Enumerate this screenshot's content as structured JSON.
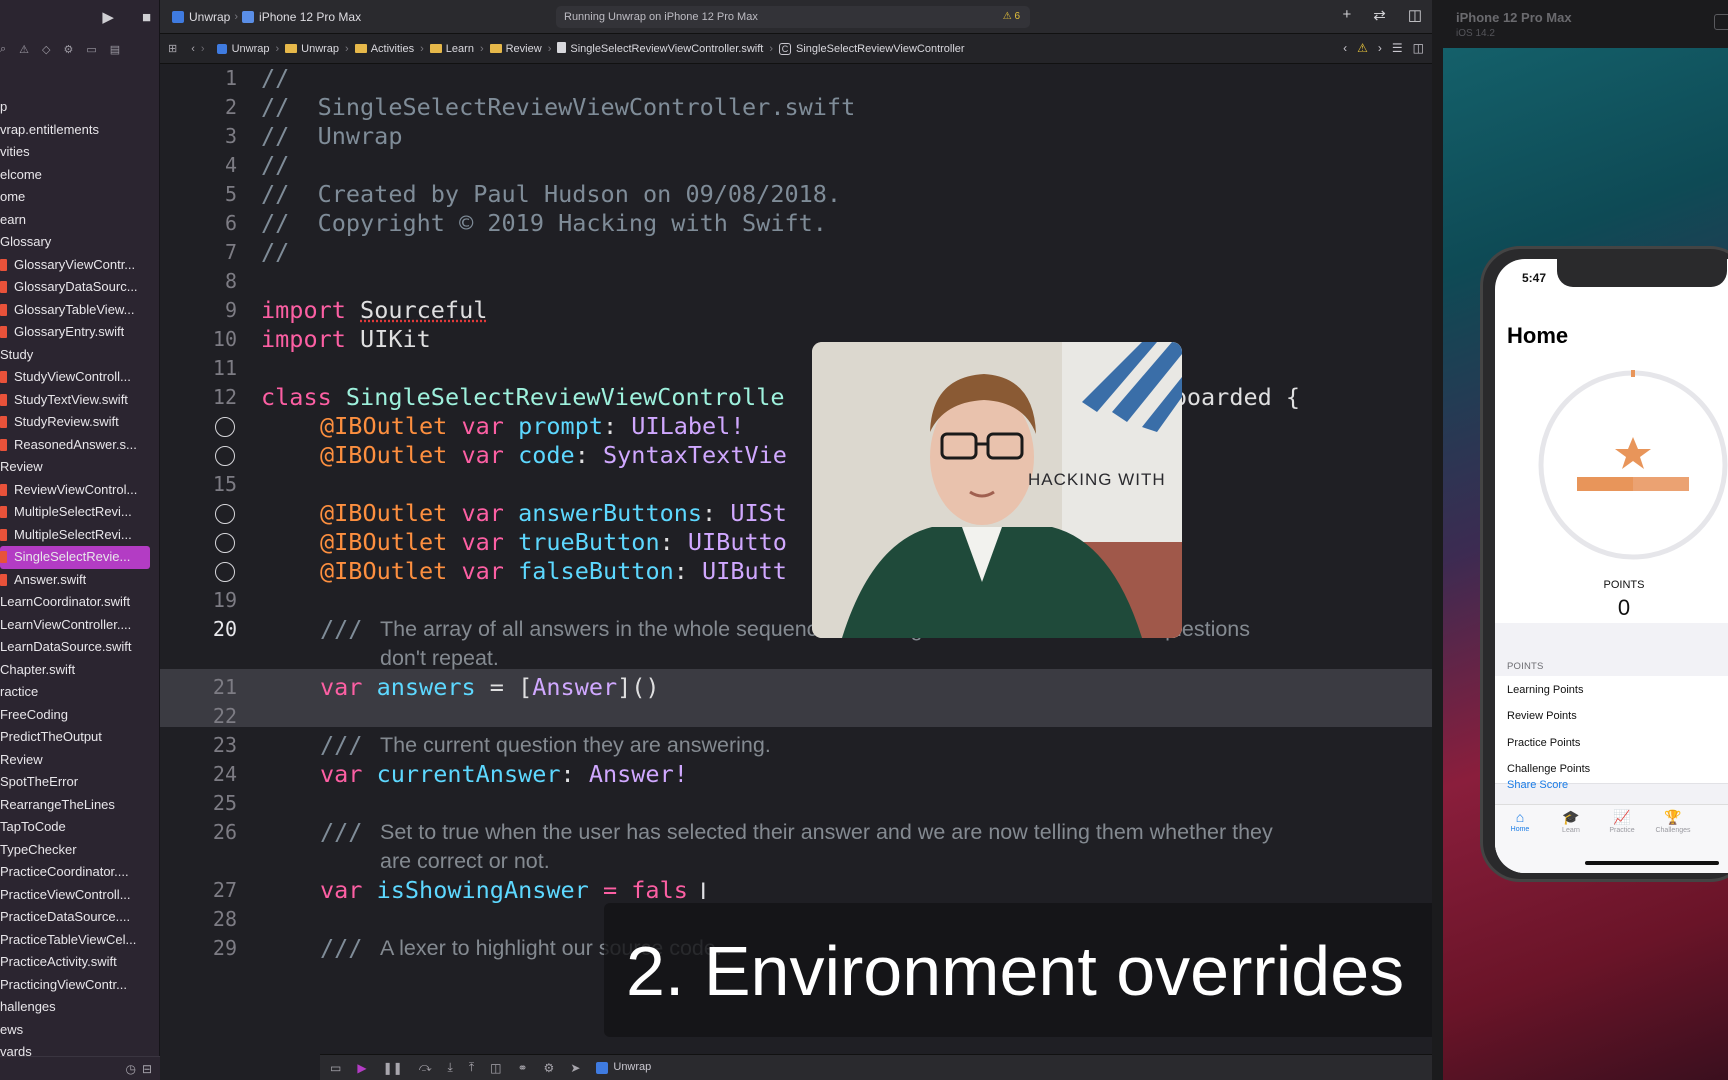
{
  "toolbar": {
    "scheme": "Unwrap",
    "device": "iPhone 12 Pro Max",
    "activity": "Running Unwrap on iPhone 12 Pro Max",
    "warnings": "6"
  },
  "jump_bar": [
    "Unwrap",
    "Unwrap",
    "Activities",
    "Learn",
    "Review",
    "SingleSelectReviewViewController.swift",
    "SingleSelectReviewViewController"
  ],
  "sidebar": {
    "items": [
      {
        "label": "p",
        "kind": "folder"
      },
      {
        "label": "vrap.entitlements",
        "kind": "folder"
      },
      {
        "label": "vities",
        "kind": "folder"
      },
      {
        "label": "elcome",
        "kind": "folder"
      },
      {
        "label": "ome",
        "kind": "folder"
      },
      {
        "label": "earn",
        "kind": "folder"
      },
      {
        "label": "Glossary",
        "kind": "folder"
      },
      {
        "label": "GlossaryViewContr...",
        "kind": "file"
      },
      {
        "label": "GlossaryDataSourc...",
        "kind": "file"
      },
      {
        "label": "GlossaryTableView...",
        "kind": "file"
      },
      {
        "label": "GlossaryEntry.swift",
        "kind": "file"
      },
      {
        "label": "Study",
        "kind": "folder"
      },
      {
        "label": "StudyViewControll...",
        "kind": "file"
      },
      {
        "label": "StudyTextView.swift",
        "kind": "file"
      },
      {
        "label": "StudyReview.swift",
        "kind": "file"
      },
      {
        "label": "ReasonedAnswer.s...",
        "kind": "file"
      },
      {
        "label": "Review",
        "kind": "folder"
      },
      {
        "label": "ReviewViewControl...",
        "kind": "file"
      },
      {
        "label": "MultipleSelectRevi...",
        "kind": "file"
      },
      {
        "label": "MultipleSelectRevi...",
        "kind": "file"
      },
      {
        "label": "SingleSelectRevie...",
        "kind": "file",
        "selected": true
      },
      {
        "label": "Answer.swift",
        "kind": "file"
      },
      {
        "label": "LearnCoordinator.swift",
        "kind": "folder"
      },
      {
        "label": "LearnViewController....",
        "kind": "folder"
      },
      {
        "label": "LearnDataSource.swift",
        "kind": "folder"
      },
      {
        "label": "Chapter.swift",
        "kind": "folder"
      },
      {
        "label": "ractice",
        "kind": "folder"
      },
      {
        "label": "FreeCoding",
        "kind": "folder"
      },
      {
        "label": "PredictTheOutput",
        "kind": "folder"
      },
      {
        "label": "Review",
        "kind": "folder"
      },
      {
        "label": "SpotTheError",
        "kind": "folder"
      },
      {
        "label": "RearrangeTheLines",
        "kind": "folder"
      },
      {
        "label": "TapToCode",
        "kind": "folder"
      },
      {
        "label": "TypeChecker",
        "kind": "folder"
      },
      {
        "label": "PracticeCoordinator....",
        "kind": "folder"
      },
      {
        "label": "PracticeViewControll...",
        "kind": "folder"
      },
      {
        "label": "PracticeDataSource....",
        "kind": "folder"
      },
      {
        "label": "PracticeTableViewCel...",
        "kind": "folder"
      },
      {
        "label": "PracticeActivity.swift",
        "kind": "folder"
      },
      {
        "label": "PracticingViewContr...",
        "kind": "folder"
      },
      {
        "label": "hallenges",
        "kind": "folder"
      },
      {
        "label": "ews",
        "kind": "folder"
      },
      {
        "label": "vards",
        "kind": "folder"
      }
    ]
  },
  "code": {
    "line_numbers": [
      "1",
      "2",
      "3",
      "4",
      "5",
      "6",
      "7",
      "8",
      "9",
      "10",
      "11",
      "12",
      "",
      "",
      "15",
      "",
      "",
      "",
      "19",
      "20",
      "21",
      "22",
      "23",
      "24",
      "25",
      "26",
      "27",
      "28",
      "29"
    ],
    "l1": "//",
    "l2": "//  SingleSelectReviewViewController.swift",
    "l3": "//  Unwrap",
    "l4": "//",
    "l5": "//  Created by Paul Hudson on 09/08/2018.",
    "l6": "//  Copyright © 2019 Hacking with Swift.",
    "l7": "//",
    "l9_kw": "import",
    "l9_mod": "Sourceful",
    "l10_kw": "import",
    "l10_mod": "UIKit",
    "l12_kw": "class",
    "l12_name": "SingleSelectReviewViewControlle",
    "l12_tail": "Storyboarded {",
    "l13": {
      "attr": "@IBOutlet",
      "kw": "var",
      "name": "prompt",
      "type": "UILabel!"
    },
    "l14": {
      "attr": "@IBOutlet",
      "kw": "var",
      "name": "code",
      "type": "SyntaxTextVie"
    },
    "l16": {
      "attr": "@IBOutlet",
      "kw": "var",
      "name": "answerButtons",
      "type": "UISt"
    },
    "l17": {
      "attr": "@IBOutlet",
      "kw": "var",
      "name": "trueButton",
      "type": "UIButto"
    },
    "l18": {
      "attr": "@IBOutlet",
      "kw": "var",
      "name": "falseButton",
      "type": "UIButt"
    },
    "l20_slash": "///",
    "l20_doc1": "The array of all answers in the whole sequence. Tracking this allows us to ensure questions",
    "l20_doc2": "don't repeat.",
    "l21": {
      "kw": "var",
      "name": "answers",
      "eq": " = [",
      "type": "Answer",
      "tail": "]()"
    },
    "l23_slash": "///",
    "l23_doc": "The current question they are answering.",
    "l24": {
      "kw": "var",
      "name": "currentAnswer",
      "sep": ": ",
      "type": "Answer!"
    },
    "l26_slash": "///",
    "l26_doc1": "Set to true when the user has selected their answer and we are now telling them whether they",
    "l26_doc2": "are correct or not.",
    "l27": {
      "kw": "var",
      "name": "isShowingAnswer",
      "tail": " = fals"
    },
    "l29_slash": "///",
    "l29_doc": "A lexer to highlight our source code."
  },
  "webcam": {
    "sign_text": "HACKING WITH"
  },
  "caption": {
    "text": "2. Environment overrides"
  },
  "debug_bar": {
    "target": "Unwrap"
  },
  "simulator": {
    "title": "iPhone 12 Pro Max",
    "subtitle": "iOS 14.2",
    "time": "5:47",
    "screen_title": "Home",
    "points_label": "POINTS",
    "points_value": "0",
    "section_header": "POINTS",
    "rows": [
      "Learning Points",
      "Review Points",
      "Practice Points",
      "Challenge Points"
    ],
    "share": "Share Score",
    "tabs": [
      "Home",
      "Learn",
      "Practice",
      "Challenges"
    ],
    "accent": "#1a7ce6"
  },
  "colors": {
    "keyword": "#fc5fa3",
    "comment": "#7f8c98",
    "selection": "#b33cc4"
  }
}
